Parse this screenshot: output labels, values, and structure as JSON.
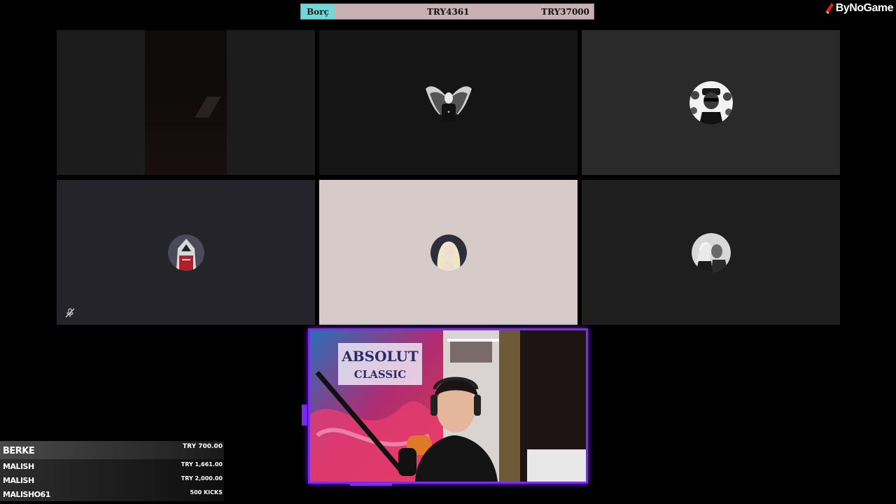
{
  "debt_bar": {
    "label": "Borç",
    "current": "TRY4361",
    "target": "TRY37000"
  },
  "logo": {
    "text": "ByNoGame"
  },
  "grid": {
    "tiles": [
      {
        "type": "camera",
        "muted": false
      },
      {
        "type": "avatar",
        "icon": "winged-avatar-icon"
      },
      {
        "type": "avatar",
        "icon": "rapper-avatar-icon"
      },
      {
        "type": "avatar",
        "icon": "hooded-assassin-avatar-icon",
        "muted": true
      },
      {
        "type": "avatar",
        "icon": "blonde-woman-avatar-icon"
      },
      {
        "type": "avatar",
        "icon": "couple-avatar-icon"
      }
    ]
  },
  "donations": [
    {
      "name": "BERKE",
      "amount": "TRY 700.00"
    },
    {
      "name": "MALISH",
      "amount": "TRY 1,661.00"
    },
    {
      "name": "MALISH",
      "amount": "TRY 2,000.00"
    },
    {
      "name": "MALISHO61",
      "amount": "500 KICKS"
    }
  ],
  "colors": {
    "debt_label_bg": "#6fd9d9",
    "debt_bar_bg": "#c9b0b4",
    "webcam_border": "#7b2cf0"
  }
}
